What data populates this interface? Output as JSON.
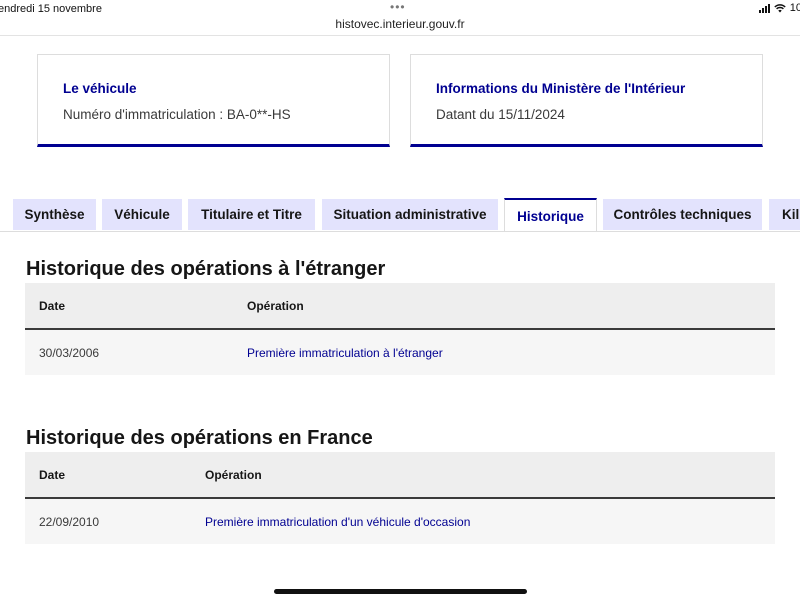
{
  "status_bar": {
    "date": "endredi 15 novembre",
    "url": "histovec.interieur.gouv.fr",
    "battery_text": "10"
  },
  "cards": {
    "vehicle": {
      "title": "Le véhicule",
      "value": "Numéro d'immatriculation : BA-0**-HS"
    },
    "ministry": {
      "title": "Informations du Ministère de l'Intérieur",
      "value": "Datant du 15/11/2024"
    }
  },
  "tabs": [
    {
      "label": "Synthèse"
    },
    {
      "label": "Véhicule"
    },
    {
      "label": "Titulaire et Titre"
    },
    {
      "label": "Situation administrative"
    },
    {
      "label": "Historique"
    },
    {
      "label": "Contrôles techniques"
    },
    {
      "label": "Kil"
    }
  ],
  "active_tab": "Historique",
  "sections": {
    "abroad": {
      "title": "Historique des opérations à l'étranger",
      "headers": [
        "Date",
        "Opération"
      ],
      "rows": [
        {
          "date": "30/03/2006",
          "operation": "Première immatriculation à l'étranger"
        }
      ]
    },
    "france": {
      "title": "Historique des opérations en France",
      "headers": [
        "Date",
        "Opération"
      ],
      "rows": [
        {
          "date": "22/09/2010",
          "operation": "Première immatriculation d'un véhicule d'occasion"
        }
      ]
    }
  },
  "colors": {
    "accent": "#000091",
    "tab_bg": "#e3e3fd",
    "table_header_bg": "#eeeeee",
    "table_row_bg": "#f6f6f6"
  }
}
